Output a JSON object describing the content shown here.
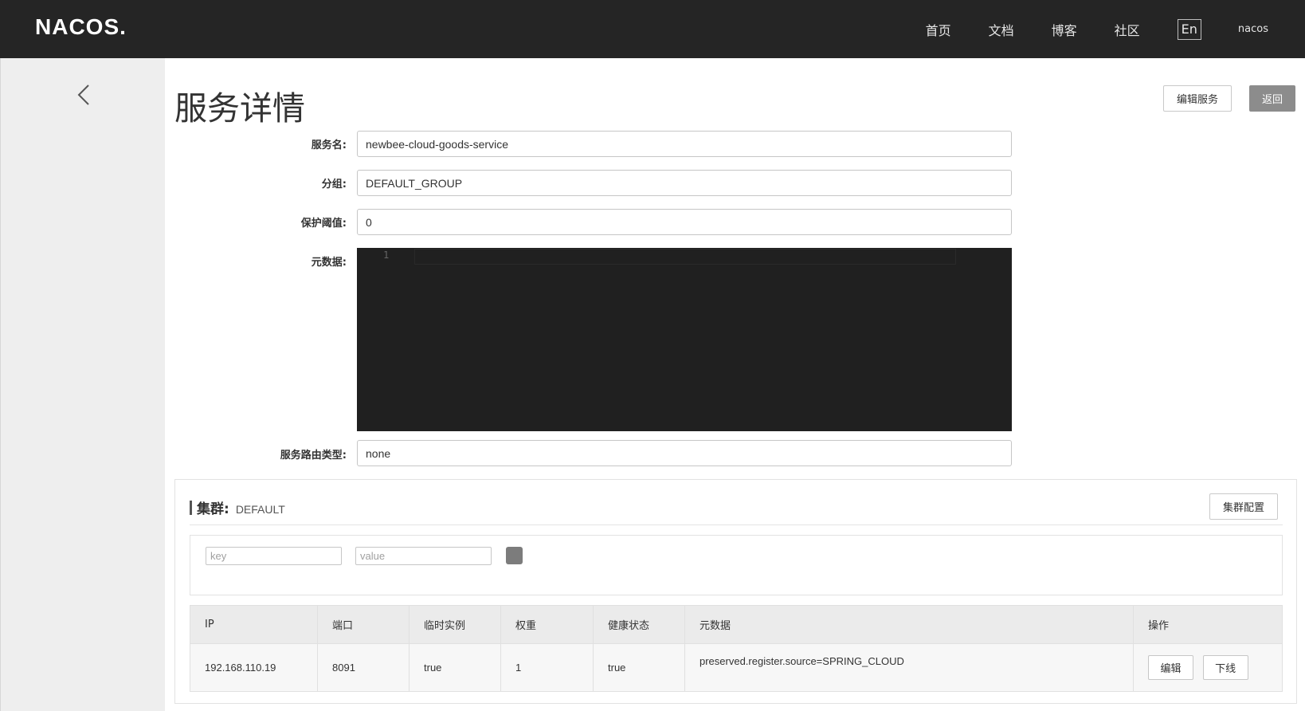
{
  "header": {
    "logo": "NACOS.",
    "nav": [
      "首页",
      "文档",
      "博客",
      "社区"
    ],
    "lang": "En",
    "user": "nacos"
  },
  "sidebar": {
    "back_icon": "chevron-left-icon"
  },
  "page": {
    "title": "服务详情",
    "edit_service": "编辑服务",
    "back": "返回"
  },
  "form": {
    "service_name_label": "服务名:",
    "service_name": "newbee-cloud-goods-service",
    "group_label": "分组:",
    "group": "DEFAULT_GROUP",
    "threshold_label": "保护阈值:",
    "threshold": "0",
    "metadata_label": "元数据:",
    "metadata_line": "1",
    "route_label": "服务路由类型:",
    "route": "none"
  },
  "cluster": {
    "title": "集群:",
    "name": "DEFAULT",
    "config_button": "集群配置",
    "key_placeholder": "key",
    "value_placeholder": "value",
    "columns": [
      "IP",
      "端口",
      "临时实例",
      "权重",
      "健康状态",
      "元数据",
      "操作"
    ],
    "rows": [
      {
        "ip": "192.168.110.19",
        "port": "8091",
        "ephemeral": "true",
        "weight": "1",
        "healthy": "true",
        "metadata": "preserved.register.source=SPRING_CLOUD",
        "edit": "编辑",
        "offline": "下线"
      }
    ]
  },
  "colors": {
    "topbar": "#252525",
    "sidebar": "#eeeeee",
    "editor": "#202020",
    "dark_button": "#8c8c8c"
  }
}
